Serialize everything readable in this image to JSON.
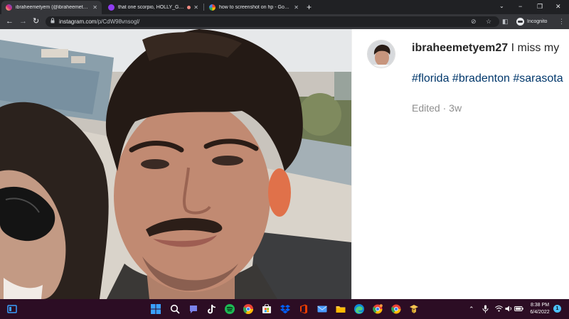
{
  "browser": {
    "tabs": [
      {
        "label": "ibraheemetyem (@ibraheemetyem) • Instagram",
        "color": "#e1306c",
        "active": true
      },
      {
        "label": "that one scorpio, HOLLY_GUZ...",
        "color": "#8f3cf0",
        "active": false
      },
      {
        "label": "how to screenshot on hp - Google Search",
        "color": "#4285f4",
        "active": false
      }
    ],
    "new_tab": "+",
    "window_controls": {
      "minimize": "−",
      "restore": "❐",
      "close": "✕"
    },
    "address": {
      "host": "instagram.com",
      "path": "/p/CdW98vnsogl/"
    },
    "profile_label": "Incognito",
    "nav": {
      "back": "←",
      "forward": "→",
      "reload": "↻"
    }
  },
  "post": {
    "username": "ibraheemetyem27",
    "caption": "I miss my",
    "hashtags": "#florida #bradenton #sarasota",
    "edited_label": "Edited",
    "separator": " · ",
    "age": "3w"
  },
  "taskbar": {
    "tray_chevron": "⌃",
    "clock_time": "8:38 PM",
    "clock_date": "6/4/2022",
    "notification_count": "1",
    "colors": {
      "widgets": "#3aa0ff",
      "start": "#3aa0ff",
      "teams": "#7b83eb",
      "spotify": "#1db954",
      "chrome": "#ea4335",
      "store": "#f2f2f2",
      "dropbox": "#0061ff",
      "office": "#eb3c00",
      "mail": "#4a9cff",
      "explorer": "#ffc83d",
      "edge": "#0f8ad6"
    }
  }
}
